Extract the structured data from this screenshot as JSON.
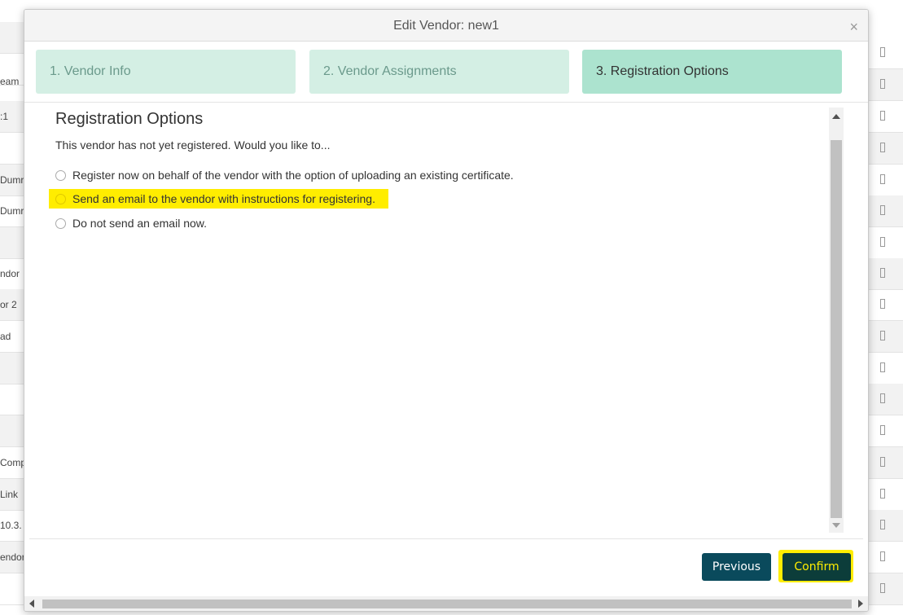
{
  "background": {
    "left_rows": [
      "",
      "",
      "eam",
      ":1",
      "",
      "Dumr",
      "Dumr",
      "",
      "ndor",
      "or 2",
      "ad",
      "",
      "",
      "",
      "Comp",
      "Link",
      "10.3.",
      "endor",
      ""
    ]
  },
  "modal": {
    "title": "Edit Vendor: new1",
    "close_symbol": "×",
    "steps": [
      {
        "label": "1. Vendor Info"
      },
      {
        "label": "2. Vendor Assignments"
      },
      {
        "label": "3. Registration Options"
      }
    ],
    "section_title": "Registration Options",
    "intro": "This vendor has not yet registered. Would you like to...",
    "options": [
      {
        "label": "Register now on behalf of the vendor with the option of uploading an existing certificate."
      },
      {
        "label": "Send an email to the vendor with instructions for registering."
      },
      {
        "label": "Do not send an email now."
      }
    ],
    "buttons": {
      "previous": "Previous",
      "confirm": "Confirm"
    }
  },
  "colors": {
    "step_inactive": "#d4efe4",
    "step_active": "#ace3cf",
    "button": "#0a4a5c",
    "highlight": "#ffed00"
  }
}
